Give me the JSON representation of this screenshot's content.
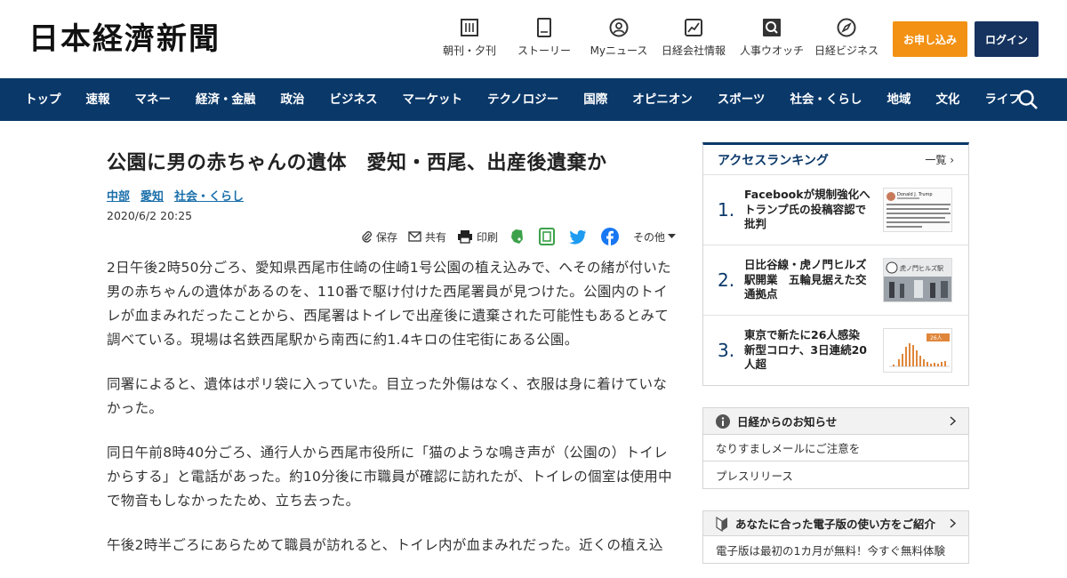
{
  "header": {
    "logo": "日本経濟新聞",
    "nav": [
      {
        "label": "朝刊・夕刊",
        "icon": "newspaper-icon"
      },
      {
        "label": "ストーリー",
        "icon": "book-icon"
      },
      {
        "label": "Myニュース",
        "icon": "person-icon"
      },
      {
        "label": "日経会社情報",
        "icon": "chart-icon"
      },
      {
        "label": "人事ウオッチ",
        "icon": "search-person-icon"
      },
      {
        "label": "日経ビジネス",
        "icon": "compass-icon"
      }
    ],
    "subscribe_label": "お申し込み",
    "login_label": "ログイン"
  },
  "main_nav": [
    "トップ",
    "速報",
    "マネー",
    "経済・金融",
    "政治",
    "ビジネス",
    "マーケット",
    "テクノロジー",
    "国際",
    "オピニオン",
    "スポーツ",
    "社会・くらし",
    "地域",
    "文化",
    "ライフ"
  ],
  "article": {
    "title": "公園に男の赤ちゃんの遺体　愛知・西尾、出産後遺棄か",
    "tags": [
      "中部",
      "愛知",
      "社会・くらし"
    ],
    "date": "2020/6/2 20:25",
    "tools": {
      "save": "保存",
      "share": "共有",
      "print": "印刷",
      "more": "その他"
    },
    "paragraphs": [
      "2日午後2時50分ごろ、愛知県西尾市住崎の住崎1号公園の植え込みで、へその緒が付いた男の赤ちゃんの遺体があるのを、110番で駆け付けた西尾署員が見つけた。公園内のトイレが血まみれだったことから、西尾署はトイレで出産後に遺棄された可能性もあるとみて調べている。現場は名鉄西尾駅から南西に約1.4キロの住宅街にある公園。",
      "同署によると、遺体はポリ袋に入っていた。目立った外傷はなく、衣服は身に着けていなかった。",
      "同日午前8時40分ごろ、通行人から西尾市役所に「猫のような鳴き声が（公園の）トイレからする」と電話があった。約10分後に市職員が確認に訪れたが、トイレの個室は使用中で物音もしなかったため、立ち去った。",
      "午後2時半ごろにあらためて職員が訪れると、トイレ内が血まみれだった。近くの植え込"
    ]
  },
  "ranking": {
    "title": "アクセスランキング",
    "more": "一覧",
    "items": [
      {
        "num": "1.",
        "text": "Facebookが規制強化へ　トランプ氏の投稿容認で批判",
        "thumb_name": "Donald J. Trump"
      },
      {
        "num": "2.",
        "text": "日比谷線・虎ノ門ヒルズ駅開業　五輪見据えた交通拠点",
        "thumb_name": "虎ノ門ヒルズ駅"
      },
      {
        "num": "3.",
        "text": "東京で新たに26人感染　新型コロナ、3日連続20人超",
        "thumb_name": "26人"
      }
    ]
  },
  "notice": {
    "title": "日経からのお知らせ",
    "rows": [
      "なりすましメールにご注意を",
      "プレスリリース"
    ]
  },
  "guide": {
    "title": "あなたに合った電子版の使い方をご紹介",
    "row": "電子版は最初の1カ月が無料！今すぐ無料体験"
  },
  "colors": {
    "navy": "#0a3869",
    "orange": "#f29114",
    "login": "#16335f",
    "link": "#1a6faa"
  }
}
